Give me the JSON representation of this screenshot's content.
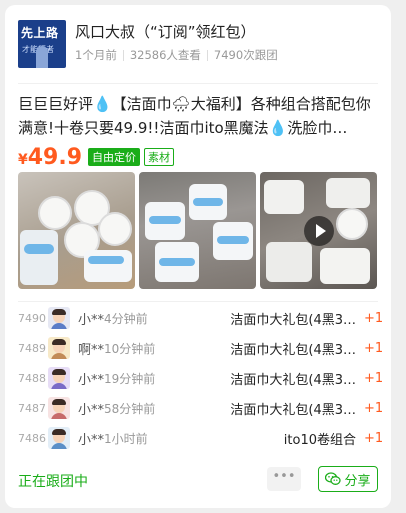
{
  "header": {
    "avatar_text": "先上路",
    "avatar_subtext": "才能行者",
    "author": "风口大叔（“订阅”领红包）",
    "posted": "1个月前",
    "views": "32586人查看",
    "joins": "7490次跟团"
  },
  "post": {
    "description": "巨巨巨好评💧【洁面巾🌧大福利】各种组合搭配包你满意!十卷只要49.9!!洁面巾ito黑魔法💧洗脸巾…",
    "price_symbol": "¥",
    "price": "49.9",
    "tag_free_price": "自由定价",
    "tag_material": "素材"
  },
  "photos": [
    {
      "name": "product-photo-1"
    },
    {
      "name": "product-photo-2"
    },
    {
      "name": "product-photo-3",
      "icon": "play-icon"
    }
  ],
  "orders": [
    {
      "no": "7490",
      "user": "小**",
      "time": "4分钟前",
      "item": "洁面巾大礼包(4黑3…",
      "qty": "+1",
      "avatar_color": "#e6e8f3"
    },
    {
      "no": "7489",
      "user": "啊**",
      "time": "10分钟前",
      "item": "洁面巾大礼包(4黑3…",
      "qty": "+1",
      "avatar_color": "#f7e9c8"
    },
    {
      "no": "7488",
      "user": "小**",
      "time": "19分钟前",
      "item": "洁面巾大礼包(4黑3…",
      "qty": "+1",
      "avatar_color": "#e7ddf6"
    },
    {
      "no": "7487",
      "user": "小**",
      "time": "58分钟前",
      "item": "洁面巾大礼包(4黑3…",
      "qty": "+1",
      "avatar_color": "#f7e3e3"
    },
    {
      "no": "7486",
      "user": "小**",
      "time": "1小时前",
      "item": "ito10卷组合",
      "qty": "+1",
      "avatar_color": "#e3eef7"
    }
  ],
  "footer": {
    "status": "正在跟团中",
    "more_label": "•••",
    "share_label": "分享"
  },
  "colors": {
    "accent_green": "#1aad19",
    "price_orange": "#ff5a1f"
  }
}
